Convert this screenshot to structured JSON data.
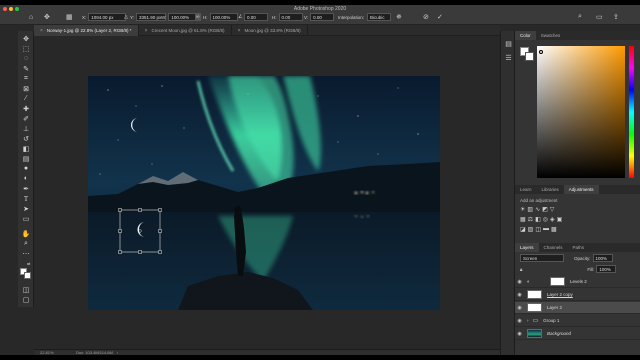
{
  "app": {
    "title": "Adobe Photoshop 2020"
  },
  "options_bar": {
    "x_label": "X:",
    "x_value": "1094.00 px",
    "y_label": "Y:",
    "y_value": "3351.90 px",
    "w_label": "W:",
    "w_value": "100.00%",
    "h_label": "H:",
    "h_value": "100.00%",
    "angle_value": "0.00",
    "hskew_label": "H:",
    "hskew_value": "0.00",
    "vskew_label": "V:",
    "vskew_value": "0.00",
    "interpolation_label": "Interpolation:",
    "interpolation_value": "Bicubic"
  },
  "tabs": [
    {
      "label": "Norway-1.jpg @ 22.8% (Layer 2, RGB/8) *",
      "active": true
    },
    {
      "label": "Crecent Moon.jpg @ 61.8% (RGB/8)",
      "active": false
    },
    {
      "label": "Moon.jpg @ 33.8% (RGB/8)",
      "active": false
    }
  ],
  "status": {
    "zoom": "22.81%",
    "doc": "Doc: 103.4M/114.6M"
  },
  "color_panel": {
    "tabs": [
      "Color",
      "Swatches"
    ]
  },
  "adjust_panel": {
    "tabs": [
      "Learn",
      "Libraries",
      "Adjustments"
    ],
    "add_label": "Add an adjustment"
  },
  "layers_panel": {
    "tabs": [
      "Layers",
      "Channels",
      "Paths"
    ],
    "blend_mode": "Screen",
    "opacity_label": "Opacity:",
    "opacity_value": "100%",
    "fill_label": "Fill:",
    "fill_value": "100%",
    "layers": [
      {
        "name": "Levels 2"
      },
      {
        "name": "Layer 2 copy"
      },
      {
        "name": "Layer 2"
      },
      {
        "name": "Group 1"
      },
      {
        "name": "Background"
      }
    ]
  },
  "colors": {
    "accent": "#0a84ff",
    "aurora": "#37d39b",
    "panel": "#343434",
    "workspace": "#282828"
  }
}
